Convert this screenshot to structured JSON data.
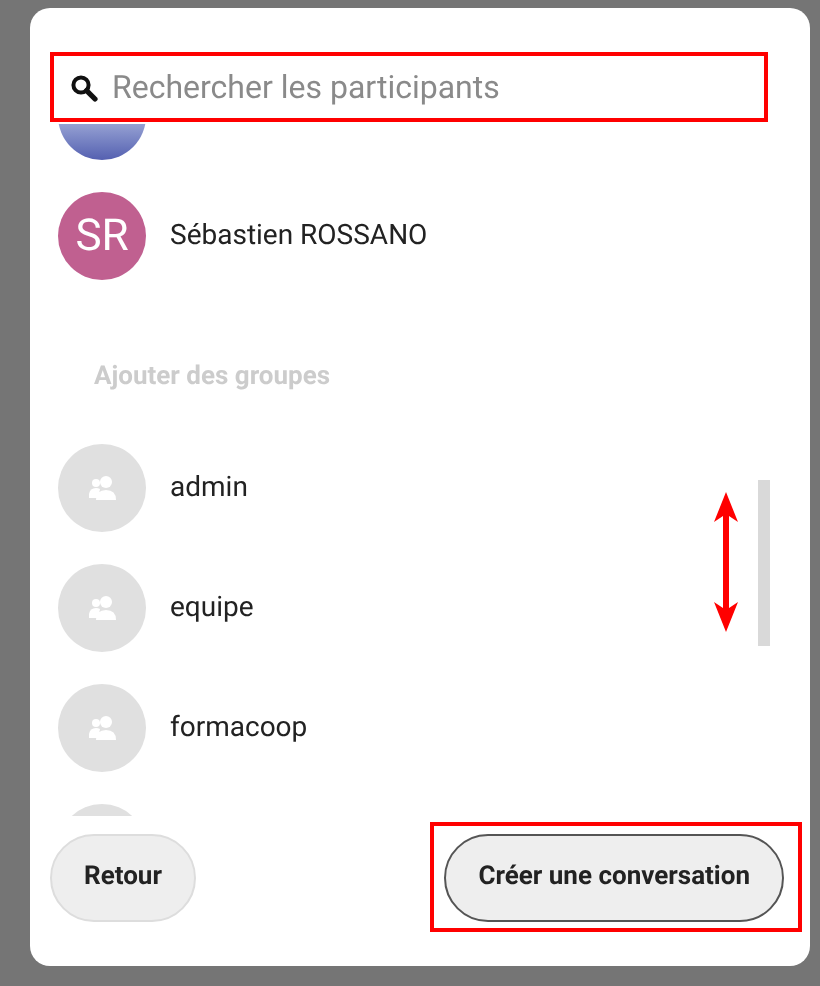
{
  "search": {
    "placeholder": "Rechercher les participants"
  },
  "participants": [
    {
      "initials": "SR",
      "name": "Sébastien ROSSANO"
    }
  ],
  "groups_heading": "Ajouter des groupes",
  "groups": [
    {
      "name": "admin"
    },
    {
      "name": "equipe"
    },
    {
      "name": "formacoop"
    }
  ],
  "buttons": [
    {
      "label": "Retour",
      "kind": "plain"
    },
    {
      "label": "Créer une conversation",
      "kind": "outlined"
    }
  ]
}
